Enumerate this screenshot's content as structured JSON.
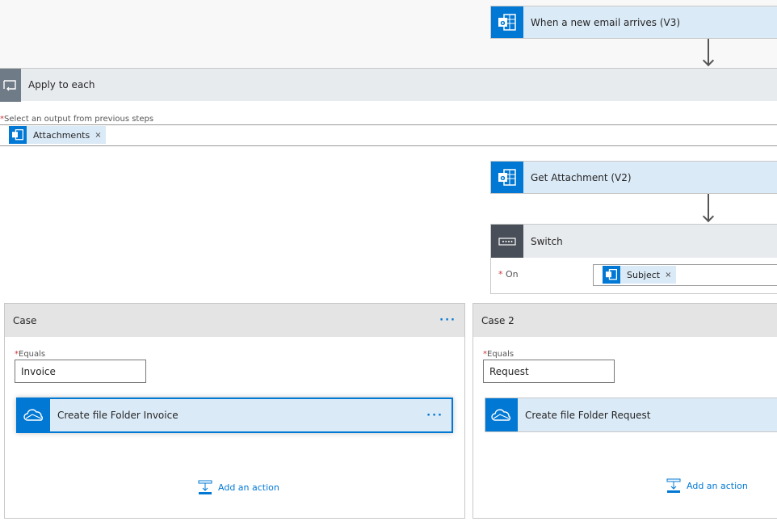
{
  "trigger": {
    "title": "When a new email arrives (V3)",
    "icon": "outlook-icon"
  },
  "apply_to_each": {
    "title": "Apply to each",
    "icon": "loop-icon",
    "field_label": "Select an output from previous steps",
    "token": "Attachments",
    "token_remove": "×"
  },
  "get_attachment": {
    "title": "Get Attachment (V2)",
    "icon": "outlook-icon"
  },
  "switch": {
    "title": "Switch",
    "icon": "switch-icon",
    "on_label": "On",
    "token": "Subject",
    "token_remove": "×"
  },
  "cases": [
    {
      "title": "Case",
      "menu": "···",
      "equals_label": "Equals",
      "equals_value": "Invoice",
      "action": "Create file Folder Invoice",
      "action_menu": "···",
      "add_action": "Add an action"
    },
    {
      "title": "Case 2",
      "equals_label": "Equals",
      "equals_value": "Request",
      "action": "Create file Folder Request",
      "add_action": "Add an action"
    }
  ],
  "required_mark": "*",
  "colors": {
    "accent": "#0078d4",
    "card_bg": "#dbeaf7",
    "switch_icon_bg": "#484f58",
    "loop_icon_bg": "#6f7b87"
  }
}
